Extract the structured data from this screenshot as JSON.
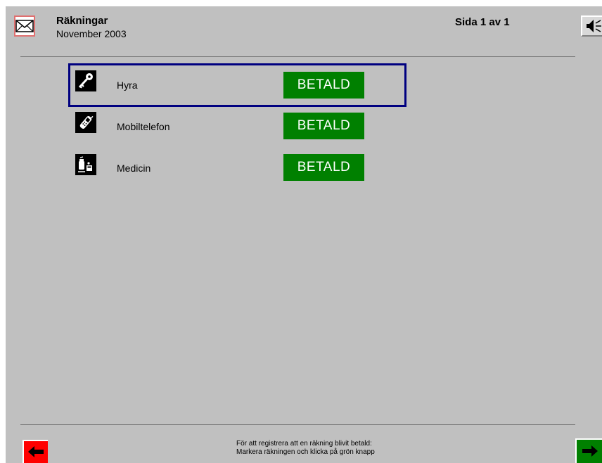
{
  "header": {
    "title": "Räkningar",
    "subtitle": "November 2003",
    "page_indicator": "Sida 1 av 1",
    "mail_icon": "envelope-icon",
    "speaker_icon": "speaker-icon"
  },
  "bills": [
    {
      "name": "Hyra",
      "status": "BETALD",
      "icon": "key-icon",
      "selected": true
    },
    {
      "name": "Mobiltelefon",
      "status": "BETALD",
      "icon": "mobile-phone-icon",
      "selected": false
    },
    {
      "name": "Medicin",
      "status": "BETALD",
      "icon": "medicine-icon",
      "selected": false
    }
  ],
  "footer": {
    "instruction_line1": "För att registrera att en räkning blivit betald:",
    "instruction_line2": "Markera räkningen och klicka på grön knapp",
    "back_icon": "arrow-left-icon",
    "forward_icon": "arrow-right-icon"
  },
  "colors": {
    "background": "#c0c0c0",
    "paid": "#008000",
    "selection": "#000080",
    "back_button": "#ff0000",
    "forward_button": "#008000"
  }
}
